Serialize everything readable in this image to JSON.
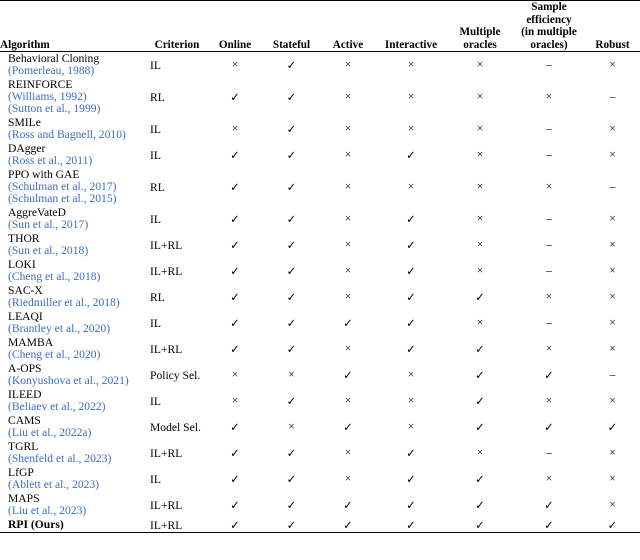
{
  "table": {
    "columns": [
      {
        "key": "algorithm",
        "label": "Algorithm"
      },
      {
        "key": "criterion",
        "label": "Criterion"
      },
      {
        "key": "online",
        "label": "Online"
      },
      {
        "key": "stateful",
        "label": "Stateful"
      },
      {
        "key": "active",
        "label": "Active"
      },
      {
        "key": "interactive",
        "label": "Interactive"
      },
      {
        "key": "multiple_oracles",
        "label": "Multiple\noracles"
      },
      {
        "key": "sample_efficiency",
        "label": "Sample\nefficiency\n(in multiple\noracles)"
      },
      {
        "key": "robust",
        "label": "Robust"
      }
    ],
    "header_labels": {
      "algorithm": "Algorithm",
      "criterion": "Criterion",
      "online": "Online",
      "stateful": "Stateful",
      "active": "Active",
      "interactive": "Interactive",
      "multiple_oracles_line1": "Multiple",
      "multiple_oracles_line2": "oracles",
      "sample_efficiency_line1": "Sample",
      "sample_efficiency_line2": "efficiency",
      "sample_efficiency_line3": "(in multiple",
      "sample_efficiency_line4": "oracles)",
      "robust": "Robust"
    },
    "marks": {
      "check": "✓",
      "cross": "×",
      "dash": "–"
    },
    "citation_color": "#3a6ec4",
    "rows": [
      {
        "name": "Behavioral Cloning",
        "citations": [
          "(Pomerleau, 1988)"
        ],
        "bold": false,
        "criterion": "IL",
        "online": "cross",
        "stateful": "check",
        "active": "cross",
        "interactive": "cross",
        "multiple_oracles": "cross",
        "sample_efficiency": "dash",
        "robust": "cross"
      },
      {
        "name": "REINFORCE",
        "citations": [
          "(Williams, 1992)",
          "(Sutton et al., 1999)"
        ],
        "bold": false,
        "criterion": "RL",
        "online": "check",
        "stateful": "check",
        "active": "cross",
        "interactive": "cross",
        "multiple_oracles": "cross",
        "sample_efficiency": "cross",
        "robust": "dash"
      },
      {
        "name": "SMILe",
        "citations": [
          "(Ross and Bagnell, 2010)"
        ],
        "bold": false,
        "criterion": "IL",
        "online": "cross",
        "stateful": "check",
        "active": "cross",
        "interactive": "cross",
        "multiple_oracles": "cross",
        "sample_efficiency": "dash",
        "robust": "cross"
      },
      {
        "name": "DAgger",
        "citations": [
          "(Ross et al., 2011)"
        ],
        "bold": false,
        "criterion": "IL",
        "online": "check",
        "stateful": "check",
        "active": "cross",
        "interactive": "check",
        "multiple_oracles": "cross",
        "sample_efficiency": "dash",
        "robust": "cross"
      },
      {
        "name": "PPO with GAE",
        "citations": [
          "(Schulman et al., 2017)",
          "(Schulman et al., 2015)"
        ],
        "bold": false,
        "criterion": "RL",
        "online": "check",
        "stateful": "check",
        "active": "cross",
        "interactive": "cross",
        "multiple_oracles": "cross",
        "sample_efficiency": "cross",
        "robust": "dash"
      },
      {
        "name": "AggreVateD",
        "citations": [
          "(Sun et al., 2017)"
        ],
        "bold": false,
        "criterion": "IL",
        "online": "check",
        "stateful": "check",
        "active": "cross",
        "interactive": "check",
        "multiple_oracles": "cross",
        "sample_efficiency": "dash",
        "robust": "cross"
      },
      {
        "name": "THOR",
        "citations": [
          "(Sun et al., 2018)"
        ],
        "bold": false,
        "criterion": "IL+RL",
        "online": "check",
        "stateful": "check",
        "active": "cross",
        "interactive": "check",
        "multiple_oracles": "cross",
        "sample_efficiency": "dash",
        "robust": "cross"
      },
      {
        "name": "LOKI",
        "citations": [
          "(Cheng et al., 2018)"
        ],
        "bold": false,
        "criterion": "IL+RL",
        "online": "check",
        "stateful": "check",
        "active": "cross",
        "interactive": "check",
        "multiple_oracles": "cross",
        "sample_efficiency": "dash",
        "robust": "cross"
      },
      {
        "name": "SAC-X",
        "citations": [
          "(Riedmiller et al., 2018)"
        ],
        "bold": false,
        "criterion": "RL",
        "online": "check",
        "stateful": "check",
        "active": "cross",
        "interactive": "check",
        "multiple_oracles": "check",
        "sample_efficiency": "cross",
        "robust": "cross"
      },
      {
        "name": "LEAQI",
        "citations": [
          "(Brantley et al., 2020)"
        ],
        "bold": false,
        "criterion": "IL",
        "online": "check",
        "stateful": "check",
        "active": "check",
        "interactive": "check",
        "multiple_oracles": "cross",
        "sample_efficiency": "dash",
        "robust": "cross"
      },
      {
        "name": "MAMBA",
        "citations": [
          "(Cheng et al., 2020)"
        ],
        "bold": false,
        "criterion": "IL+RL",
        "online": "check",
        "stateful": "check",
        "active": "cross",
        "interactive": "check",
        "multiple_oracles": "check",
        "sample_efficiency": "cross",
        "robust": "cross"
      },
      {
        "name": "A-OPS",
        "citations": [
          "(Konyushova et al., 2021)"
        ],
        "bold": false,
        "criterion": "Policy Sel.",
        "online": "cross",
        "stateful": "cross",
        "active": "check",
        "interactive": "cross",
        "multiple_oracles": "check",
        "sample_efficiency": "check",
        "robust": "dash"
      },
      {
        "name": "ILEED",
        "citations": [
          "(Beliaev et al., 2022)"
        ],
        "bold": false,
        "criterion": "IL",
        "online": "cross",
        "stateful": "check",
        "active": "cross",
        "interactive": "cross",
        "multiple_oracles": "check",
        "sample_efficiency": "cross",
        "robust": "cross"
      },
      {
        "name": "CAMS",
        "citations": [
          "(Liu et al., 2022a)"
        ],
        "bold": false,
        "criterion": "Model Sel.",
        "online": "check",
        "stateful": "cross",
        "active": "check",
        "interactive": "cross",
        "multiple_oracles": "check",
        "sample_efficiency": "check",
        "robust": "check"
      },
      {
        "name": "TGRL",
        "citations": [
          "(Shenfeld et al., 2023)"
        ],
        "bold": false,
        "criterion": "IL+RL",
        "online": "check",
        "stateful": "check",
        "active": "cross",
        "interactive": "check",
        "multiple_oracles": "cross",
        "sample_efficiency": "dash",
        "robust": "cross"
      },
      {
        "name": "LfGP",
        "citations": [
          "(Ablett et al., 2023)"
        ],
        "bold": false,
        "criterion": "IL",
        "online": "check",
        "stateful": "check",
        "active": "cross",
        "interactive": "check",
        "multiple_oracles": "check",
        "sample_efficiency": "cross",
        "robust": "cross"
      },
      {
        "name": "MAPS",
        "citations": [
          "(Liu et al., 2023)"
        ],
        "bold": false,
        "criterion": "IL+RL",
        "online": "check",
        "stateful": "check",
        "active": "check",
        "interactive": "check",
        "multiple_oracles": "check",
        "sample_efficiency": "check",
        "robust": "cross"
      },
      {
        "name": "RPI (Ours)",
        "citations": [],
        "bold": true,
        "criterion": "IL+RL",
        "online": "check",
        "stateful": "check",
        "active": "check",
        "interactive": "check",
        "multiple_oracles": "check",
        "sample_efficiency": "check",
        "robust": "check"
      }
    ]
  }
}
